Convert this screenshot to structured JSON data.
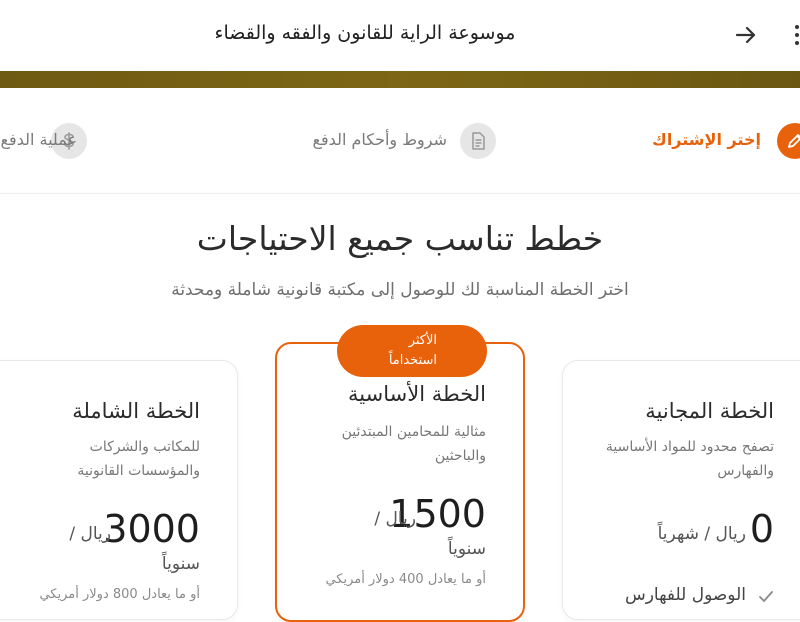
{
  "header": {
    "title": "موسوعة الراية للقانون والفقه والقضاء",
    "back_icon": "arrow-right-icon",
    "menu_icon": "more-vertical-icon"
  },
  "stepper": {
    "steps": [
      {
        "label": "إختر الإشتراك",
        "icon": "pencil-icon",
        "state": "active"
      },
      {
        "label": "شروط وأحكام الدفع",
        "icon": "document-icon",
        "state": "inactive"
      },
      {
        "label": "عملية الدفع",
        "icon": "dollar-icon",
        "state": "inactive"
      }
    ]
  },
  "main": {
    "title": "خطط تناسب جميع الاحتياجات",
    "subtitle": "اختر الخطة المناسبة لك للوصول إلى مكتبة قانونية شاملة ومحدثة"
  },
  "plans": {
    "free": {
      "name": "الخطة المجانية",
      "description": "تصفح محدود للمواد الأساسية والفهارس",
      "price": "0",
      "unit": "ريال / شهرياً",
      "feature": "الوصول للفهارس"
    },
    "basic": {
      "badge_line1": "الأكثر",
      "badge_line2": "استخداماً",
      "name": "الخطة الأساسية",
      "description": "مثالية للمحامين المبتدئين والباحثين",
      "price": "1500",
      "unit": "ريال /",
      "period": "سنوياً",
      "note": "أو ما يعادل 400 دولار أمريكي"
    },
    "full": {
      "name": "الخطة الشاملة",
      "description": "للمكاتب والشركات والمؤسسات القانونية",
      "price": "3000",
      "unit": "ريال /",
      "period": "سنوياً",
      "note": "أو ما يعادل 800 دولار أمريكي"
    }
  },
  "colors": {
    "accent": "#e8620c",
    "gold_bar": "#7a6414",
    "inactive_step": "#7a7a7a"
  }
}
